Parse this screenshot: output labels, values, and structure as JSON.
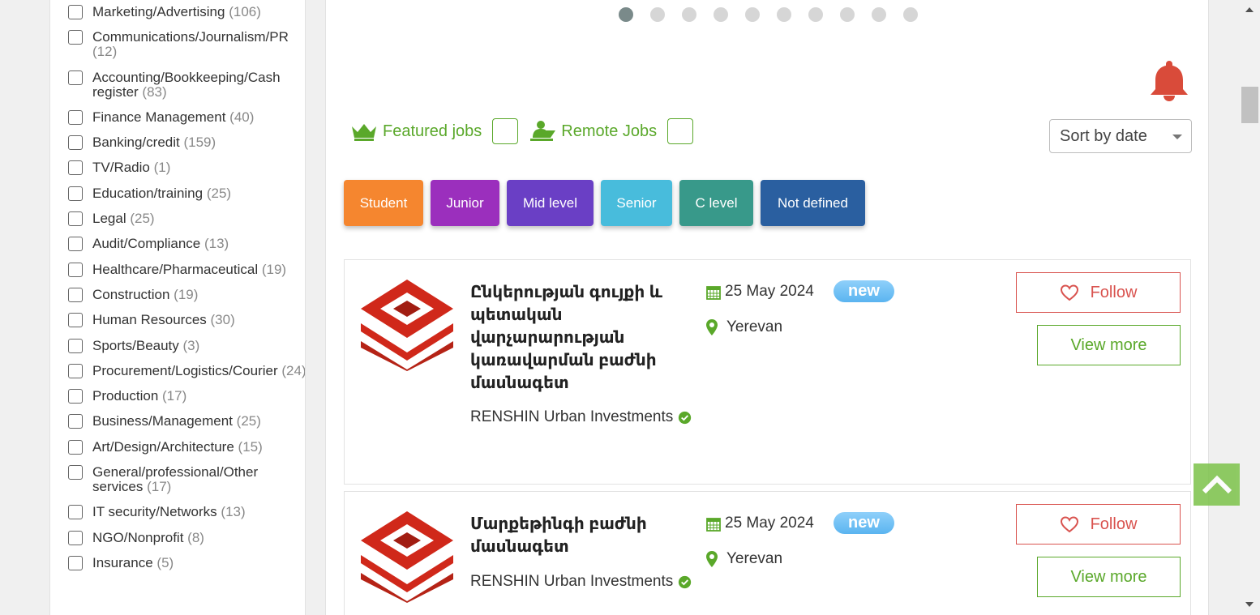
{
  "categories": [
    {
      "name": "Marketing/Advertising",
      "count": "(106)"
    },
    {
      "name": "Communications/Journalism/PR",
      "count": "(12)"
    },
    {
      "name": "Accounting/Bookkeeping/Cash register",
      "count": "(83)"
    },
    {
      "name": "Finance Management",
      "count": "(40)"
    },
    {
      "name": "Banking/credit",
      "count": "(159)"
    },
    {
      "name": "TV/Radio",
      "count": "(1)"
    },
    {
      "name": "Education/training",
      "count": "(25)"
    },
    {
      "name": "Legal",
      "count": "(25)"
    },
    {
      "name": "Audit/Compliance",
      "count": "(13)"
    },
    {
      "name": "Healthcare/Pharmaceutical",
      "count": "(19)"
    },
    {
      "name": "Construction",
      "count": "(19)"
    },
    {
      "name": "Human Resources",
      "count": "(30)"
    },
    {
      "name": "Sports/Beauty",
      "count": "(3)"
    },
    {
      "name": "Procurement/Logistics/Courier",
      "count": "(24)"
    },
    {
      "name": "Production",
      "count": "(17)"
    },
    {
      "name": "Business/Management",
      "count": "(25)"
    },
    {
      "name": "Art/Design/Architecture",
      "count": "(15)"
    },
    {
      "name": "General/professional/Other services",
      "count": "(17)"
    },
    {
      "name": "IT security/Networks",
      "count": "(13)"
    },
    {
      "name": "NGO/Nonprofit",
      "count": "(8)"
    },
    {
      "name": "Insurance",
      "count": "(5)"
    }
  ],
  "carousel": {
    "total": 10,
    "active": 1
  },
  "filters": {
    "featured_label": "Featured jobs",
    "remote_label": "Remote Jobs",
    "sort_label": "Sort by date"
  },
  "levels": [
    {
      "label": "Student",
      "color": "#f5862f"
    },
    {
      "label": "Junior",
      "color": "#9b2fbd"
    },
    {
      "label": "Mid level",
      "color": "#6a3fc5"
    },
    {
      "label": "Senior",
      "color": "#48bcdc"
    },
    {
      "label": "C level",
      "color": "#38998a"
    },
    {
      "label": "Not defined",
      "color": "#2a5fa0"
    }
  ],
  "jobs": [
    {
      "title": "Ընկերության գույքի և պետական վարչարարության կառավարման բաժնի մասնագետ",
      "company": "RENSHIN Urban Investments",
      "date": "25 May 2024",
      "location": "Yerevan",
      "badge": "new",
      "follow_label": "Follow",
      "view_label": "View more"
    },
    {
      "title": "Մարքեթինգի բաժնի մասնագետ",
      "company": "RENSHIN Urban Investments",
      "date": "25 May 2024",
      "location": "Yerevan",
      "badge": "new",
      "follow_label": "Follow",
      "view_label": "View more"
    }
  ],
  "colors": {
    "accent_green": "#5aa82a",
    "follow_red": "#d9534f",
    "bell_red": "#d94b3a"
  }
}
